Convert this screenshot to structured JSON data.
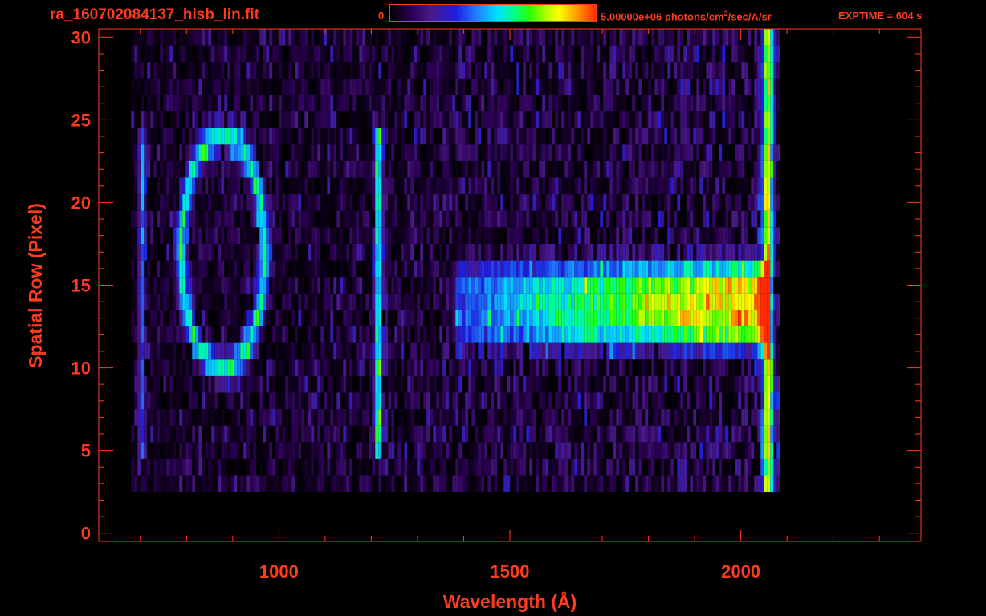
{
  "header": {
    "filename": "ra_160702084137_hisb_lin.fit",
    "colorbar_min": "0",
    "colorbar_max_value": "5.00000e+06 photons/cm",
    "colorbar_max_exp": "2",
    "colorbar_max_unit_tail": "/sec/A/sr",
    "exptime": "EXPTIME = 604 s"
  },
  "colors": {
    "axis": "#ff3b1f",
    "background": "#000000"
  },
  "chart_data": {
    "type": "heatmap",
    "xlabel": "Wavelength (Å)",
    "ylabel": "Spatial Row (Pixel)",
    "xlim": [
      610,
      2390
    ],
    "ylim": [
      -0.5,
      30.5
    ],
    "x_ticks": [
      1000,
      1500,
      2000
    ],
    "y_ticks": [
      0,
      5,
      10,
      15,
      20,
      25,
      30
    ],
    "colorbar_range": [
      0,
      5000000
    ],
    "data_extent": {
      "x": [
        680,
        2080
      ],
      "y": [
        3,
        30
      ]
    },
    "features": [
      {
        "name": "",
        "kind": "ring",
        "x_center": 875,
        "y_center": 17,
        "x_half_width": 90,
        "y_half_height": 7,
        "peak": 0.5
      },
      {
        "name": "",
        "kind": "vertical-line",
        "x": 1212,
        "y_range": [
          5,
          24
        ],
        "peak": 0.55
      },
      {
        "name": "",
        "kind": "vertical-line",
        "x": 700,
        "y_range": [
          5,
          24
        ],
        "peak": 0.3
      },
      {
        "name": "",
        "kind": "continuum",
        "x_range": [
          1380,
          2060
        ],
        "y_center": 13.8,
        "y_half_height": 2.6,
        "peak_start": 0.25,
        "peak_end": 0.78
      },
      {
        "name": "",
        "kind": "edge-band",
        "x": 2055,
        "y_range": [
          1,
          30
        ],
        "peak": 0.7
      }
    ]
  }
}
